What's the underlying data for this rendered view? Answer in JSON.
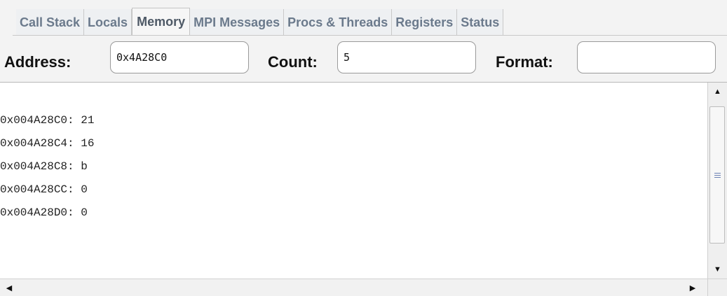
{
  "tabs": [
    {
      "label": "Call Stack",
      "selected": false
    },
    {
      "label": "Locals",
      "selected": false
    },
    {
      "label": "Memory",
      "selected": true
    },
    {
      "label": "MPI Messages",
      "selected": false
    },
    {
      "label": "Procs & Threads",
      "selected": false
    },
    {
      "label": "Registers",
      "selected": false
    },
    {
      "label": "Status",
      "selected": false
    }
  ],
  "controls": {
    "address_label": "Address:",
    "address_value": "0x4A28C0",
    "count_label": "Count:",
    "count_value": "5",
    "format_label": "Format:",
    "format_value": ""
  },
  "memory": {
    "lines": [
      "0x004A28C0: 21",
      "0x004A28C4: 16",
      "0x004A28C8: b",
      "0x004A28CC: 0",
      "0x004A28D0: 0"
    ]
  },
  "icons": {
    "up": "scroll-up-arrow-icon",
    "down": "scroll-down-arrow-icon",
    "left": "scroll-left-arrow-icon",
    "right": "scroll-right-arrow-icon"
  }
}
